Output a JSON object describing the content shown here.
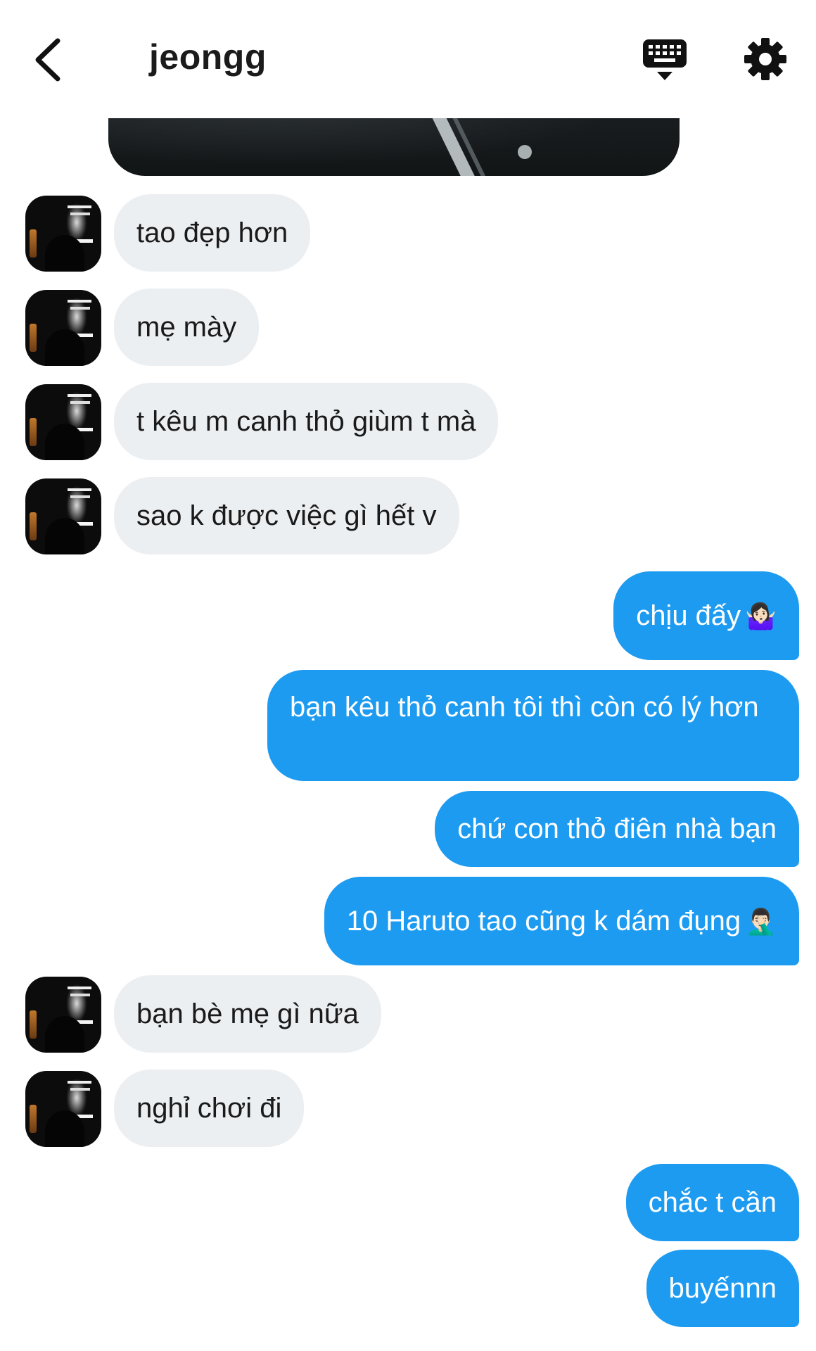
{
  "header": {
    "title": "jeongg"
  },
  "messages": [
    {
      "dir": "in",
      "text": "tao đẹp hơn"
    },
    {
      "dir": "in",
      "text": "mẹ mày"
    },
    {
      "dir": "in",
      "text": "t kêu m canh thỏ giùm t mà"
    },
    {
      "dir": "in",
      "text": "sao k được việc gì hết v"
    },
    {
      "dir": "out",
      "text": "chịu đấy",
      "emoji": "🤷🏻‍♀️"
    },
    {
      "dir": "out",
      "text": "bạn kêu thỏ canh tôi thì còn có lý hơn"
    },
    {
      "dir": "out",
      "text": "chứ con thỏ điên nhà bạn"
    },
    {
      "dir": "out",
      "text": "10 Haruto tao cũng k dám đụng",
      "emoji": "🤦🏻‍♂️"
    },
    {
      "dir": "in",
      "text": "bạn bè mẹ gì nữa"
    },
    {
      "dir": "in",
      "text": "nghỉ chơi đi"
    },
    {
      "dir": "out",
      "text": "chắc t cần"
    },
    {
      "dir": "out",
      "text": "buyếnnn"
    }
  ],
  "colors": {
    "outgoing_bubble": "#1d9bf0",
    "incoming_bubble": "#eceff2",
    "background": "#ffffff"
  },
  "icons": [
    "chevron-left-icon",
    "keyboard-icon",
    "gear-icon"
  ]
}
